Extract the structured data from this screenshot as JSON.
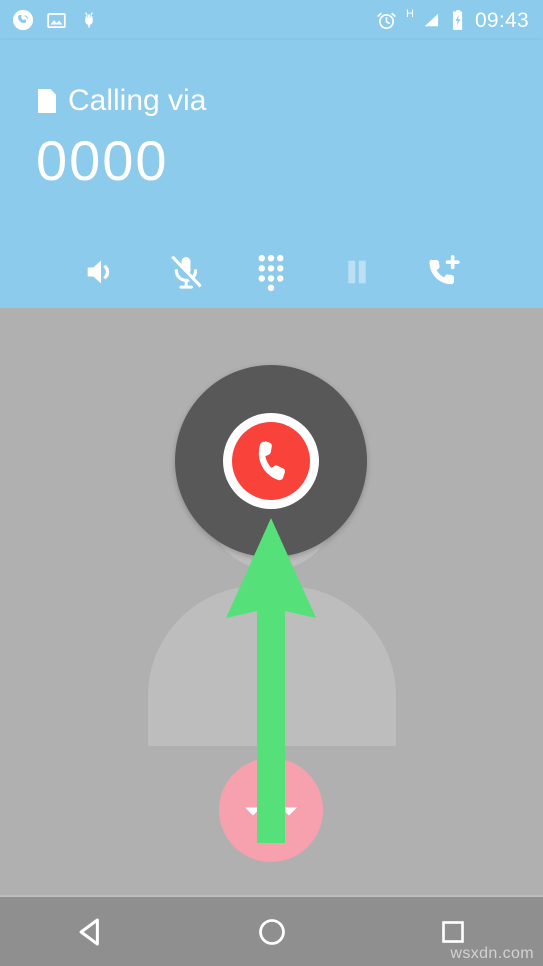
{
  "screen": {
    "name": "android-in-call-screen",
    "header_color": "#8ccbeb",
    "body_color": "#b0b0b0",
    "nav_color": "#8f8f8f",
    "accent_red": "#f9423a",
    "accent_green": "#55e07a",
    "accent_pink": "#f7a0ae"
  },
  "status_bar": {
    "left_icons": [
      {
        "name": "phone-in-call-icon",
        "label": "phone-in-call-icon"
      },
      {
        "name": "screenshot-image-icon",
        "label": "screenshot-image-icon"
      },
      {
        "name": "android-usb-debug-icon",
        "label": "android-usb-debug-icon"
      }
    ],
    "right_icons": [
      {
        "name": "alarm-clock-icon",
        "label": "alarm-clock-icon"
      },
      {
        "name": "signal-h-icon",
        "label": "H"
      },
      {
        "name": "battery-charging-icon",
        "label": "battery-charging-icon"
      }
    ],
    "clock": "09:43"
  },
  "call_header": {
    "sim_icon": "sim-card-icon",
    "calling_via_label": "Calling via",
    "phone_number": "0000"
  },
  "call_controls": [
    {
      "name": "speaker-button",
      "label": "speaker-icon",
      "enabled": true
    },
    {
      "name": "mute-button",
      "label": "mic-muted-icon",
      "enabled": true
    },
    {
      "name": "dialpad-button",
      "label": "dialpad-icon",
      "enabled": true
    },
    {
      "name": "hold-button",
      "label": "pause-icon",
      "enabled": false
    },
    {
      "name": "add-call-button",
      "label": "add-call-icon",
      "enabled": true
    }
  ],
  "call_body": {
    "avatar": "contact-avatar-placeholder",
    "end_call_button_label": "end-call-icon",
    "swipe_handle_label": "swipe-up-handle-icon",
    "annotation": "green-up-arrow-annotation"
  },
  "nav_bar": {
    "back_label": "back-icon",
    "home_label": "home-icon",
    "recents_label": "recents-icon"
  },
  "watermark": "wsxdn.com"
}
